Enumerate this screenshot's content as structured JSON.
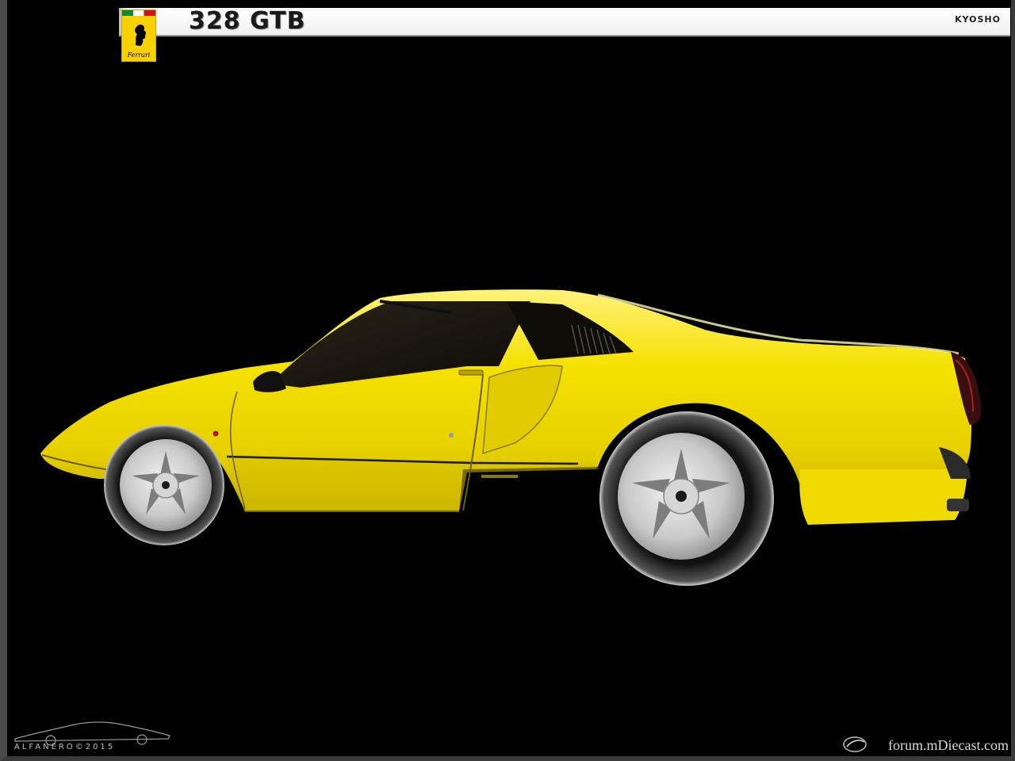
{
  "header": {
    "model": "328 GTB",
    "maker": "KYOSHO",
    "badge_brand": "Ferrari"
  },
  "photo": {
    "subject": "yellow-car-side-profile",
    "body_color": "#f5e100",
    "background_color": "#000000"
  },
  "footer": {
    "signature": "ALFANERO©2015",
    "forum": "forum.mDiecast.com"
  }
}
